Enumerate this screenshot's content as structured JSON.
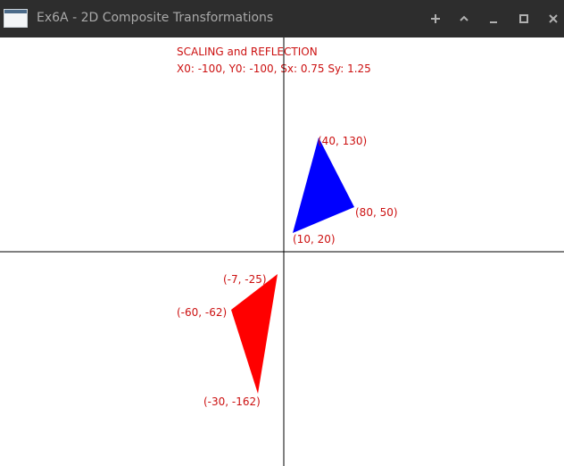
{
  "window": {
    "title": "Ex6A - 2D Composite Transformations",
    "controls": [
      "pin",
      "maximize-up",
      "minimize",
      "restore",
      "close"
    ]
  },
  "canvas": {
    "heading": "SCALING and REFLECTION",
    "params": "X0: -100, Y0: -100, Sx: 0.75 Sy: 1.25",
    "colors": {
      "label": "#cc1111",
      "axes": "#000000",
      "original": "#0000ff",
      "transformed": "#ff0000"
    },
    "original_triangle": {
      "points": [
        [
          10,
          20
        ],
        [
          40,
          130
        ],
        [
          80,
          50
        ]
      ],
      "labels": [
        "(10, 20)",
        "(40, 130)",
        "(80, 50)"
      ]
    },
    "transformed_triangle": {
      "points": [
        [
          -7,
          -25
        ],
        [
          -60,
          -62
        ],
        [
          -30,
          -162
        ]
      ],
      "labels": [
        "(-7, -25)",
        "(-60, -62)",
        "(-30, -162)"
      ]
    }
  }
}
